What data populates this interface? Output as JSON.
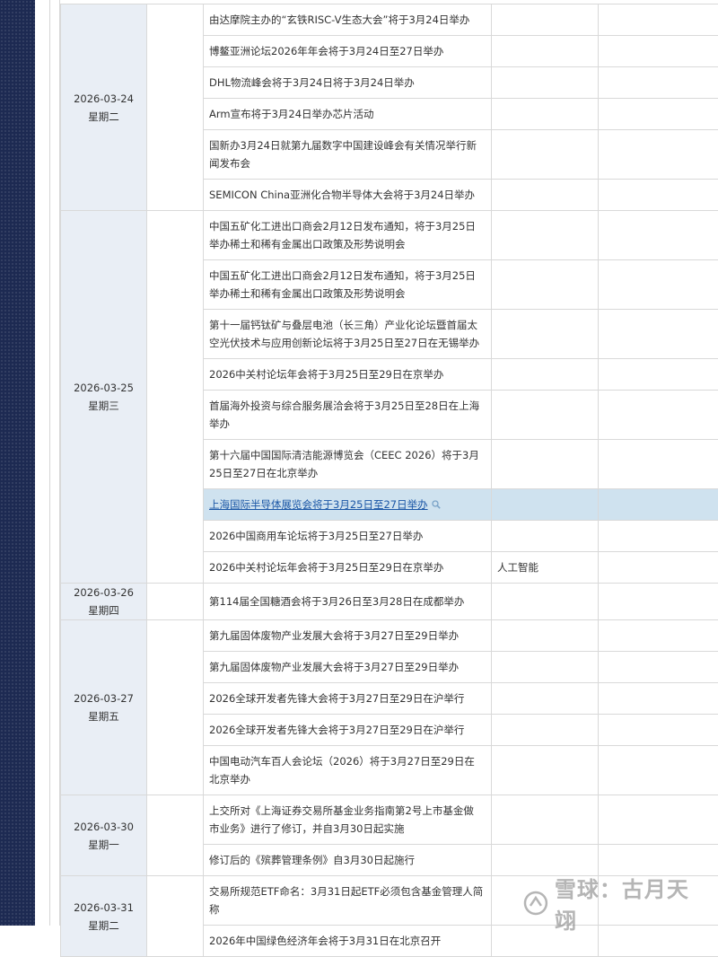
{
  "days": [
    {
      "date": "2026-03-24",
      "weekday": "星期二",
      "events": [
        {
          "text": "由达摩院主办的“玄铁RISC-V生态大会”将于3月24日举办",
          "lines": 1
        },
        {
          "text": "博鳌亚洲论坛2026年年会将于3月24日至27日举办",
          "lines": 1
        },
        {
          "text": "DHL物流峰会将于3月24日将于3月24日举办",
          "lines": 1
        },
        {
          "text": "Arm宣布将于3月24日举办芯片活动",
          "lines": 1
        },
        {
          "text": "国新办3月24日就第九届数字中国建设峰会有关情况举行新闻发布会",
          "lines": 2
        },
        {
          "text": "SEMICON China亚洲化合物半导体大会将于3月24日举办",
          "lines": 1
        }
      ]
    },
    {
      "date": "2026-03-25",
      "weekday": "星期三",
      "events": [
        {
          "text": "中国五矿化工进出口商会2月12日发布通知，将于3月25日举办稀土和稀有金属出口政策及形势说明会",
          "lines": 2
        },
        {
          "text": "中国五矿化工进出口商会2月12日发布通知，将于3月25日举办稀土和稀有金属出口政策及形势说明会",
          "lines": 2
        },
        {
          "text": "第十一届钙钛矿与叠层电池（长三角）产业化论坛暨首届太空光伏技术与应用创新论坛将于3月25日至27日在无锡举办",
          "lines": 2
        },
        {
          "text": "2026中关村论坛年会将于3月25日至29日在京举办",
          "lines": 1
        },
        {
          "text": "首届海外投资与综合服务展洽会将于3月25日至28日在上海举办",
          "lines": 2
        },
        {
          "text": "第十六届中国国际清洁能源博览会（CEEC 2026）将于3月25日至27日在北京举办",
          "lines": 2
        },
        {
          "text": "上海国际半导体展览会将于3月25日至27日举办",
          "lines": 1,
          "highlighted": true
        },
        {
          "text": "2026中国商用车论坛将于3月25日至27日举办",
          "lines": 1
        },
        {
          "text": "2026中关村论坛年会将于3月25日至29日在京举办",
          "lines": 1,
          "tag": "人工智能"
        }
      ]
    },
    {
      "date": "2026-03-26",
      "weekday": "星期四",
      "events": [
        {
          "text": "第114届全国糖酒会将于3月26日至3月28日在成都举办",
          "lines": 1
        }
      ]
    },
    {
      "date": "2026-03-27",
      "weekday": "星期五",
      "events": [
        {
          "text": "第九届固体废物产业发展大会将于3月27日至29日举办",
          "lines": 1
        },
        {
          "text": "第九届固体废物产业发展大会将于3月27日至29日举办",
          "lines": 1
        },
        {
          "text": "2026全球开发者先锋大会将于3月27日至29日在沪举行",
          "lines": 1
        },
        {
          "text": "2026全球开发者先锋大会将于3月27日至29日在沪举行",
          "lines": 1
        },
        {
          "text": "中国电动汽车百人会论坛（2026）将于3月27日至29日在北京举办",
          "lines": 2
        }
      ]
    },
    {
      "date": "2026-03-30",
      "weekday": "星期一",
      "events": [
        {
          "text": "上交所对《上海证券交易所基金业务指南第2号上市基金做市业务》进行了修订，并自3月30日起实施",
          "lines": 2
        },
        {
          "text": "修订后的《殡葬管理条例》自3月30日起施行",
          "lines": 1
        }
      ]
    },
    {
      "date": "2026-03-31",
      "weekday": "星期二",
      "events": [
        {
          "text": "交易所规范ETF命名：3月31日起ETF必须包含基金管理人简称",
          "lines": 2
        },
        {
          "text": "2026年中国绿色经济年会将于3月31日在北京召开",
          "lines": 1
        }
      ]
    }
  ],
  "watermark": {
    "text": "雪球：古月天翊"
  }
}
